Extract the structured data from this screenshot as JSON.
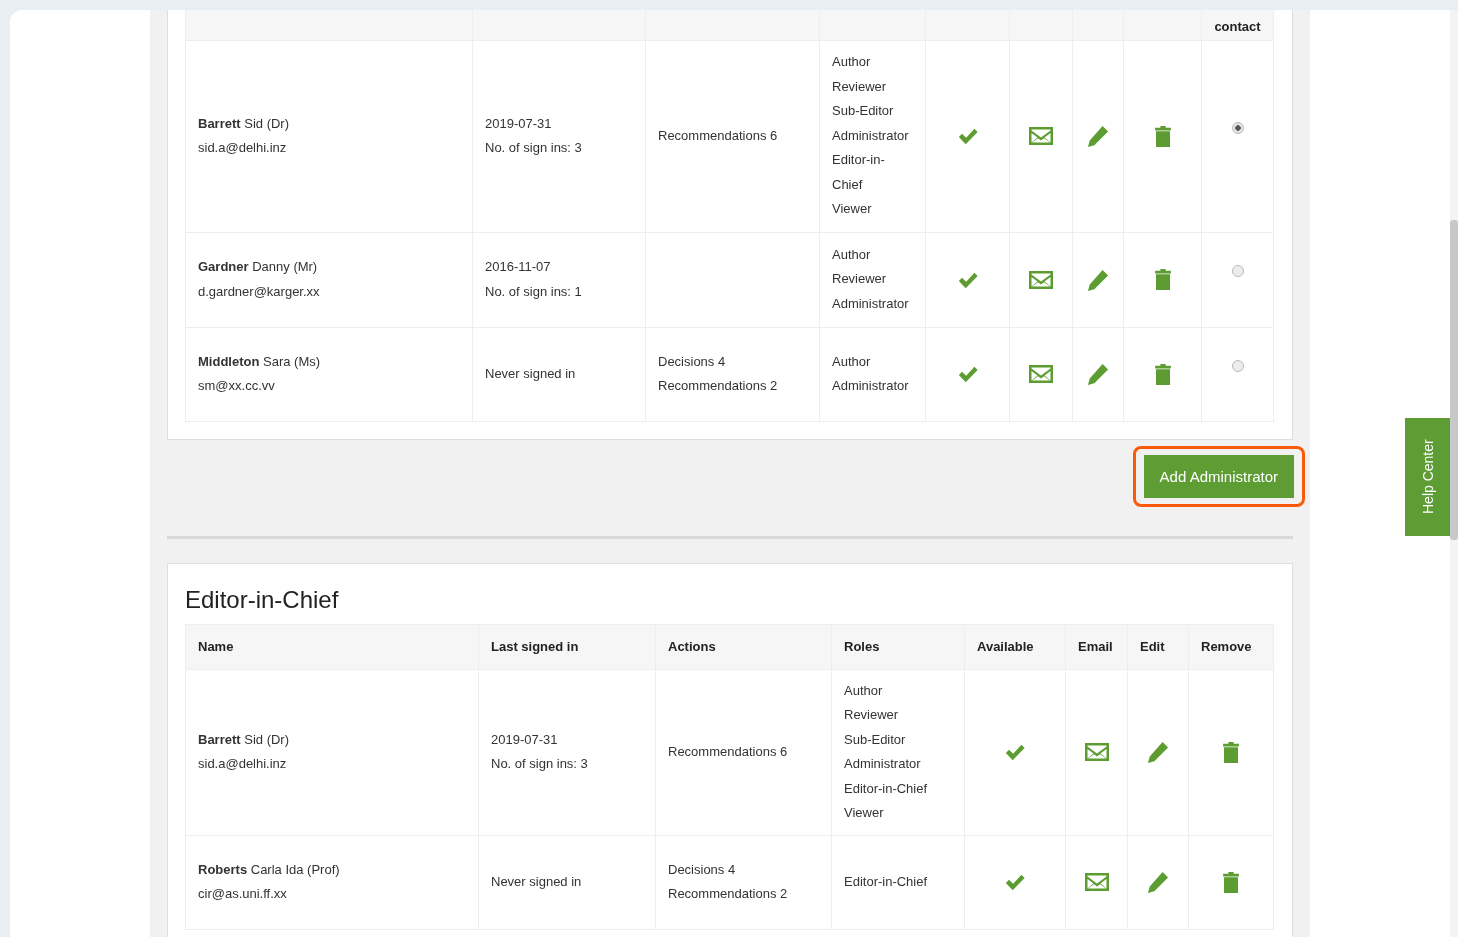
{
  "admin_table": {
    "last_column_header": "contact",
    "rows": [
      {
        "name": "**Barrett** Sid (Dr)",
        "email": "sid.a@delhi.inz",
        "last_signed_in": [
          "2019-07-31",
          "No. of sign ins: 3"
        ],
        "actions": [
          "Recommendations 6"
        ],
        "roles": [
          "Author",
          "Reviewer",
          "Sub-Editor",
          "Administrator",
          "Editor-in-Chief",
          "Viewer"
        ],
        "available": true,
        "selected": true
      },
      {
        "name": "**Gardner** Danny (Mr)",
        "email": "d.gardner@karger.xx",
        "last_signed_in": [
          "2016-11-07",
          "No. of sign ins: 1"
        ],
        "actions": [],
        "roles": [
          "Author",
          "Reviewer",
          "Administrator"
        ],
        "available": true,
        "selected": false
      },
      {
        "name": "**Middleton** Sara (Ms)",
        "email": "sm@xx.cc.vv",
        "last_signed_in": [
          "Never signed in"
        ],
        "actions": [
          "Decisions 4",
          "Recommendations 2"
        ],
        "roles": [
          "Author",
          "Administrator"
        ],
        "available": true,
        "selected": false
      }
    ]
  },
  "add_button": {
    "label": "Add Administrator",
    "highlighted": true
  },
  "editor_section": {
    "title": "Editor-in-Chief",
    "columns": [
      "Name",
      "Last signed in",
      "Actions",
      "Roles",
      "Available",
      "Email",
      "Edit",
      "Remove"
    ],
    "rows": [
      {
        "name": "**Barrett** Sid (Dr)",
        "email": "sid.a@delhi.inz",
        "last_signed_in": [
          "2019-07-31",
          "No. of sign ins: 3"
        ],
        "actions": [
          "Recommendations 6"
        ],
        "roles": [
          "Author",
          "Reviewer",
          "Sub-Editor",
          "Administrator",
          "Editor-in-Chief",
          "Viewer"
        ],
        "available": true
      },
      {
        "name": "**Roberts** Carla Ida (Prof)",
        "email": "cir@as.uni.ff.xx",
        "last_signed_in": [
          "Never signed in"
        ],
        "actions": [
          "Decisions 4",
          "Recommendations 2"
        ],
        "roles": [
          "Editor-in-Chief"
        ],
        "available": true
      }
    ]
  },
  "help_tab": {
    "label": "Help Center"
  }
}
